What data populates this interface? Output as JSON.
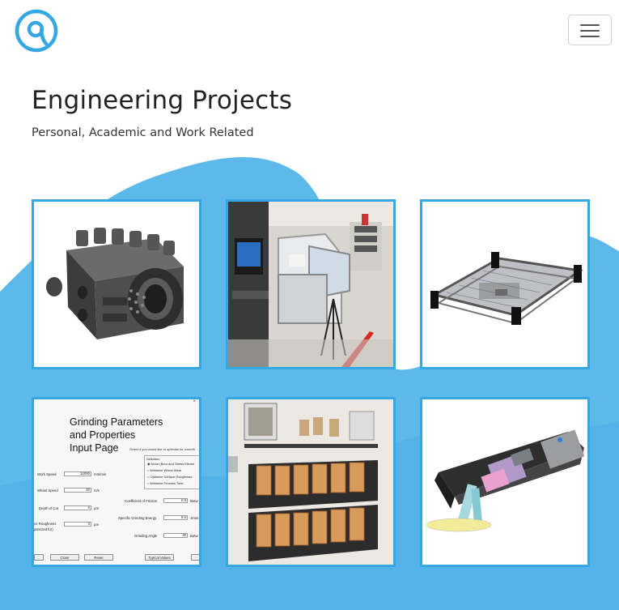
{
  "header": {
    "logo_icon": "q-logo-icon",
    "menu_icon": "hamburger-icon",
    "accent_color": "#35a7e3"
  },
  "hero": {
    "title": "Engineering Projects",
    "subtitle": "Personal, Academic and Work Related"
  },
  "background": {
    "wave_color": "#5cb9e9",
    "wave_color_dark": "#3fa8e2"
  },
  "projects": [
    {
      "name": "engine-model",
      "icon": "cad-engine-icon"
    },
    {
      "name": "lab-enclosure",
      "icon": "photo-lab-icon"
    },
    {
      "name": "frame-platform",
      "icon": "cad-frame-icon"
    },
    {
      "name": "grinding-app",
      "icon": "app-window-icon",
      "screenshot": {
        "title_line1": "Grinding Parameters",
        "title_line2": "and Properties",
        "title_line3": "Input Page",
        "note": "Select if you would like to optimise for someth",
        "box_title": "Selection",
        "options": [
          "None (Burn and Stress Minimi",
          "Minimize Wheel Wear",
          "Optimize Surface Roughness",
          "Minimize Process Time"
        ],
        "fields": [
          {
            "label": "Work Speed",
            "value": "12000",
            "unit": "mm/min"
          },
          {
            "label": "Wheel Speed",
            "value": "30",
            "unit": "m/s"
          },
          {
            "label": "Depth of Cut",
            "value": "0",
            "unit": "µm"
          },
          {
            "label": "ce Roughness",
            "label2": "ptimized for)",
            "value": "0",
            "unit": "µm"
          }
        ],
        "right_fields": [
          {
            "label": "Coefficient of Friction",
            "value": "0.5",
            "unit": "Betw"
          },
          {
            "label": "Specific Grinding Energy",
            "value": "9.6",
            "unit": "J/mm"
          },
          {
            "label": "Grinding Angle",
            "value": "30",
            "unit": "Betw"
          }
        ],
        "buttons": [
          "Close",
          "Reset",
          "Typical Values"
        ]
      }
    },
    {
      "name": "poster-display",
      "icon": "photo-posters-icon"
    },
    {
      "name": "mechanism-model",
      "icon": "cad-mechanism-icon"
    }
  ]
}
